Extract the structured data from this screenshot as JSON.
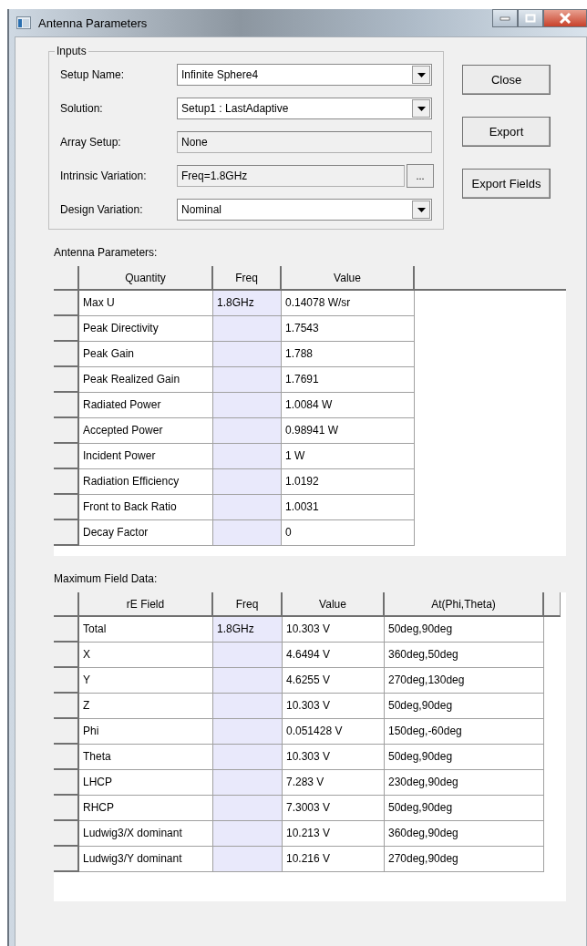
{
  "window": {
    "title": "Antenna Parameters"
  },
  "inputs": {
    "label": "Inputs",
    "fields": [
      {
        "kind": "combo",
        "label": "Setup Name:",
        "value": "Infinite Sphere4"
      },
      {
        "kind": "combo",
        "label": "Solution:",
        "value": "Setup1 : LastAdaptive"
      },
      {
        "kind": "readonly",
        "label": "Array Setup:",
        "value": "None"
      },
      {
        "kind": "browse",
        "label": "Intrinsic Variation:",
        "value": "Freq=1.8GHz",
        "button": "..."
      },
      {
        "kind": "combo",
        "label": "Design Variation:",
        "value": "Nominal"
      }
    ]
  },
  "buttons": [
    "Close",
    "Export",
    "Export Fields"
  ],
  "tables": [
    {
      "label": "Antenna Parameters:",
      "columns": [
        "Quantity",
        "Freq",
        "Value"
      ],
      "rows": [
        [
          "Max U",
          "1.8GHz",
          "0.14078 W/sr"
        ],
        [
          "Peak Directivity",
          "",
          "1.7543"
        ],
        [
          "Peak Gain",
          "",
          "1.788"
        ],
        [
          "Peak Realized Gain",
          "",
          "1.7691"
        ],
        [
          "Radiated Power",
          "",
          "1.0084 W"
        ],
        [
          "Accepted Power",
          "",
          "0.98941 W"
        ],
        [
          "Incident Power",
          "",
          "1 W"
        ],
        [
          "Radiation Efficiency",
          "",
          "1.0192"
        ],
        [
          "Front to Back Ratio",
          "",
          "1.0031"
        ],
        [
          "Decay Factor",
          "",
          "0"
        ]
      ]
    },
    {
      "label": "Maximum Field Data:",
      "columns": [
        "rE Field",
        "Freq",
        "Value",
        "At(Phi,Theta)"
      ],
      "rows": [
        [
          "Total",
          "1.8GHz",
          "10.303 V",
          "50deg,90deg"
        ],
        [
          "X",
          "",
          "4.6494 V",
          "360deg,50deg"
        ],
        [
          "Y",
          "",
          "4.6255 V",
          "270deg,130deg"
        ],
        [
          "Z",
          "",
          "10.303 V",
          "50deg,90deg"
        ],
        [
          "Phi",
          "",
          "0.051428 V",
          "150deg,-60deg"
        ],
        [
          "Theta",
          "",
          "10.303 V",
          "50deg,90deg"
        ],
        [
          "LHCP",
          "",
          "7.283 V",
          "230deg,90deg"
        ],
        [
          "RHCP",
          "",
          "7.3003 V",
          "50deg,90deg"
        ],
        [
          "Ludwig3/X dominant",
          "",
          "10.213 V",
          "360deg,90deg"
        ],
        [
          "Ludwig3/Y dominant",
          "",
          "10.216 V",
          "270deg,90deg"
        ]
      ]
    }
  ]
}
